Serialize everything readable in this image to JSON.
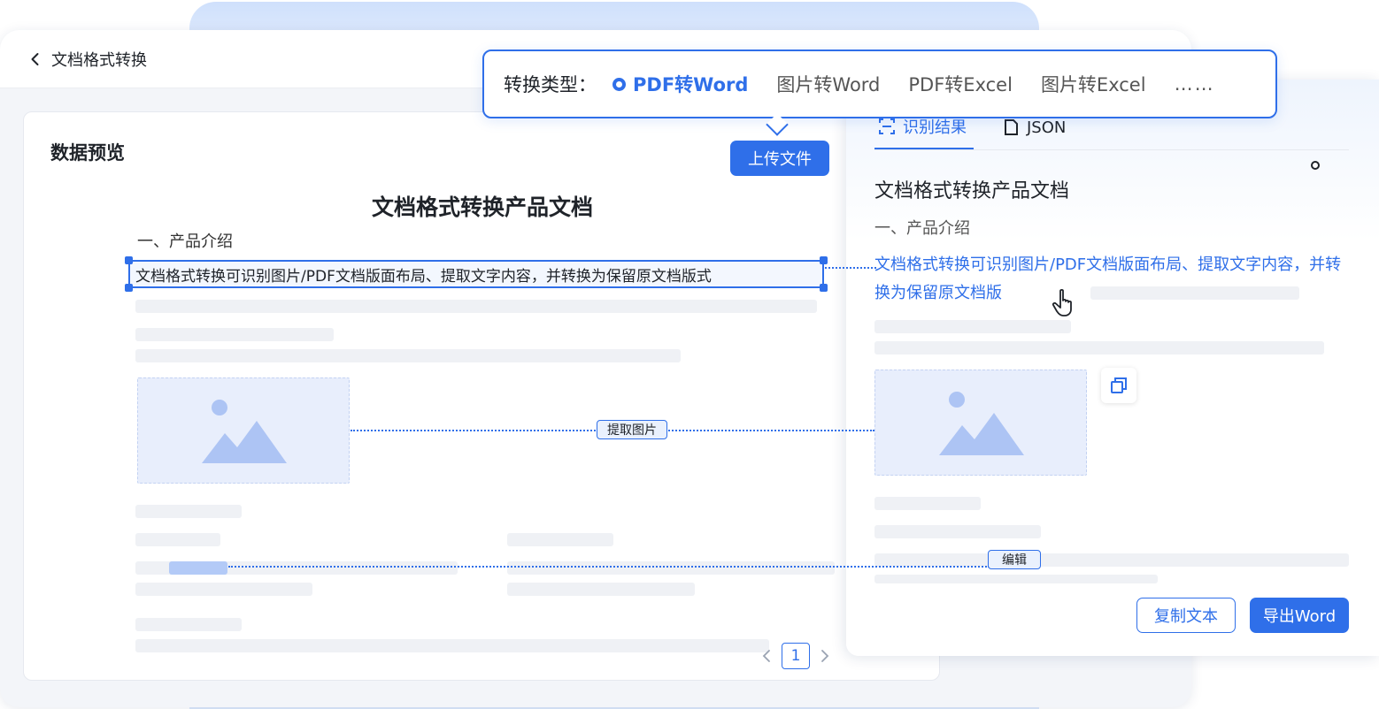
{
  "window": {
    "title": "文档格式转换"
  },
  "preview": {
    "title": "数据预览",
    "upload_label": "上传文件",
    "doc_heading": "文档格式转换产品文档",
    "section_title": "一、产品介绍",
    "selected_text": "文档格式转换可识别图片/PDF文档版面布局、提取文字内容，并转换为保留原文档版式",
    "page_number": "1"
  },
  "conversion_types": {
    "label": "转换类型：",
    "options": [
      "PDF转Word",
      "图片转Word",
      "PDF转Excel",
      "图片转Excel"
    ],
    "selected": "PDF转Word",
    "more": "……"
  },
  "result": {
    "tabs": [
      "识别结果",
      "JSON"
    ],
    "active_tab": "识别结果",
    "heading": "文档格式转换产品文档",
    "section_title": "一、产品介绍",
    "text": "文档格式转换可识别图片/PDF文档版面布局、提取文字内容，并转换为保留原文档版",
    "copy_label": "复制文本",
    "export_label": "导出Word"
  },
  "connectors": {
    "extract_image": "提取图片",
    "edit": "编辑"
  },
  "colors": {
    "accent": "#2f6fe9",
    "skeleton": "#eff1f5",
    "image_placeholder": "#e8eefc"
  }
}
